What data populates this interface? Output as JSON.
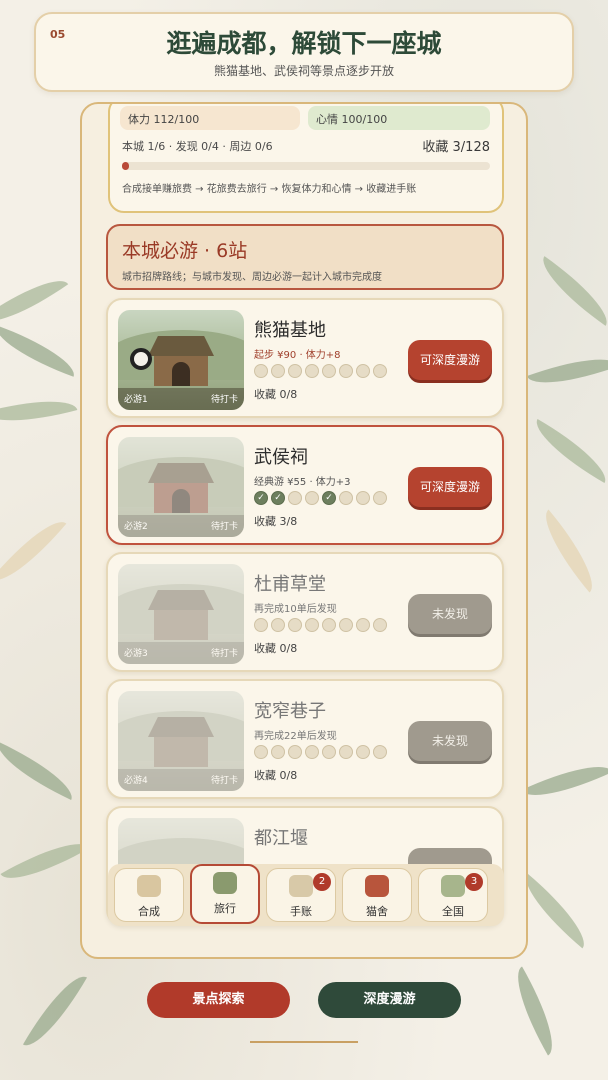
{
  "header": {
    "step": "05",
    "title": "逛遍成都，解锁下一座城",
    "subtitle": "熊猫基地、武侯祠等景点逐步开放"
  },
  "status": {
    "stamina": "体力 112/100",
    "mood": "心情 100/100",
    "progress_line": "本城 1/6 · 发现 0/4 · 周边 0/6",
    "collection_total": "收藏 3/128",
    "progress_fraction": 0.02,
    "flow": "合成接单赚旅费 → 花旅费去旅行 → 恢复体力和心情 → 收藏进手账"
  },
  "must_visit": {
    "title": "本城必游 · 6站",
    "subtitle": "城市招牌路线；与城市发现、周边必游一起计入城市完成度"
  },
  "spots": [
    {
      "name": "熊猫基地",
      "info": "起步 ¥90 · 体力+8",
      "collect": "收藏 0/8",
      "thumb_left": "必游1",
      "thumb_right": "待打卡",
      "button": "可深度漫游",
      "stamps": [
        false,
        false,
        false,
        false,
        false,
        false,
        false,
        false
      ]
    },
    {
      "name": "武侯祠",
      "info": "经典游 ¥55 · 体力+3",
      "collect": "收藏 3/8",
      "thumb_left": "必游2",
      "thumb_right": "待打卡",
      "button": "可深度漫游",
      "stamps": [
        true,
        true,
        false,
        false,
        true,
        false,
        false,
        false
      ]
    },
    {
      "name": "杜甫草堂",
      "info": "再完成10单后发现",
      "collect": "收藏 0/8",
      "thumb_left": "必游3",
      "thumb_right": "待打卡",
      "button": "未发现",
      "stamps": [
        false,
        false,
        false,
        false,
        false,
        false,
        false,
        false
      ]
    },
    {
      "name": "宽窄巷子",
      "info": "再完成22单后发现",
      "collect": "收藏 0/8",
      "thumb_left": "必游4",
      "thumb_right": "待打卡",
      "button": "未发现",
      "stamps": [
        false,
        false,
        false,
        false,
        false,
        false,
        false,
        false
      ]
    },
    {
      "name": "都江堰",
      "info": "",
      "collect": "",
      "thumb_left": "",
      "thumb_right": "",
      "button": "",
      "stamps": []
    }
  ],
  "nav": [
    {
      "label": "合成",
      "icon": "craft-icon",
      "badge": ""
    },
    {
      "label": "旅行",
      "icon": "travel-icon",
      "badge": ""
    },
    {
      "label": "手账",
      "icon": "journal-icon",
      "badge": "2"
    },
    {
      "label": "猫舍",
      "icon": "cat-house-icon",
      "badge": ""
    },
    {
      "label": "全国",
      "icon": "country-icon",
      "badge": "3"
    }
  ],
  "bottom_buttons": {
    "explore": "景点探索",
    "roam": "深度漫游"
  },
  "colors": {
    "accent_red": "#b5432f",
    "accent_green": "#2f4a3a",
    "gold": "#d9b77a"
  }
}
